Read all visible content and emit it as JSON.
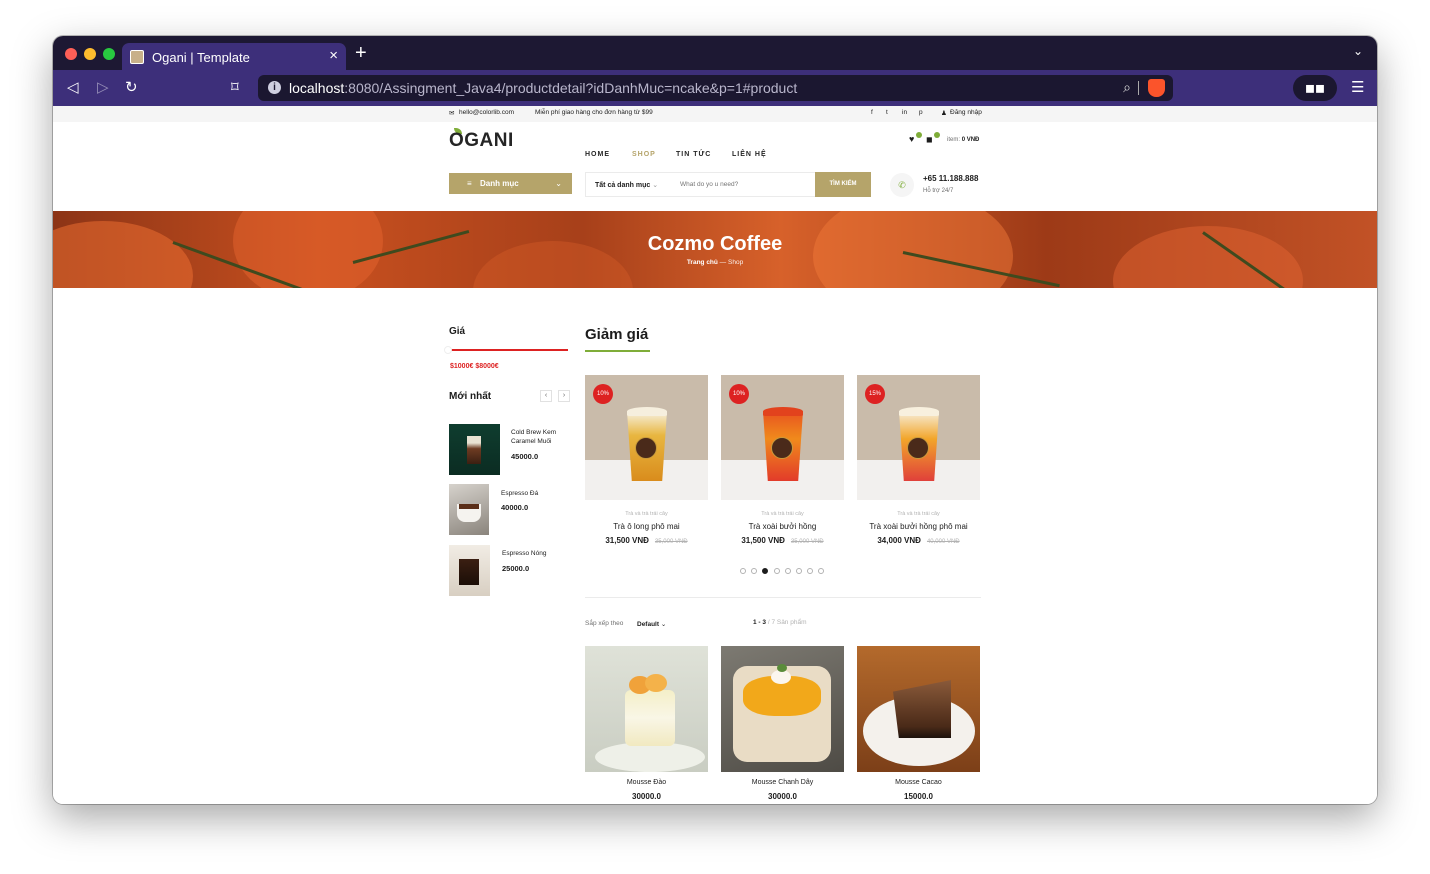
{
  "browser": {
    "tab_title": "Ogani | Template",
    "tab_close": "×",
    "new_tab": "+",
    "url_host": "localhost",
    "url_rest": ":8080/Assingment_Java4/productdetail?idDanhMuc=ncake&p=1#product",
    "info_symbol": "i",
    "icons": {
      "back": "◁",
      "forward": "▷",
      "reload": "↻",
      "bookmark": "⌑",
      "zoom": "⌕",
      "menu": "☰",
      "tab_list": "⌄",
      "glasses": "◼◼"
    }
  },
  "top_strip": {
    "email_icon": "✉",
    "email": "hello@colorlib.com",
    "shipping": "Miễn phí giao hàng cho đơn hàng từ $99",
    "social": [
      "f",
      "t",
      "in",
      "p"
    ],
    "login_icon": "♟",
    "login": "Đăng nhập"
  },
  "header": {
    "logo": "OGANI",
    "menu": [
      {
        "label": "HOME",
        "active": false
      },
      {
        "label": "SHOP",
        "active": true
      },
      {
        "label": "TIN TỨC",
        "active": false
      },
      {
        "label": "LIÊN HỆ",
        "active": false
      }
    ],
    "wishlist_icon": "♥",
    "cart_icon": "◼",
    "cart_label": "item:",
    "cart_total": "0 VNĐ",
    "categories_button": "Danh mục",
    "categories_icon": "≡",
    "categories_chevron": "⌄",
    "search_category": "Tất cả danh mục",
    "search_placeholder": "What do yo u need?",
    "search_button": "TÌM KIẾM",
    "phone_icon": "✆",
    "phone": "+65 11.188.888",
    "support": "Hỗ trợ 24/7"
  },
  "hero": {
    "title": "Cozmo Coffee",
    "breadcrumb_home": "Trang chủ",
    "breadcrumb_sep": " — ",
    "breadcrumb_current": "Shop"
  },
  "sidebar": {
    "price_title": "Giá",
    "price_min": "$1000€",
    "price_max": "$8000€",
    "latest_title": "Mới nhất",
    "prev": "‹",
    "next": "›",
    "latest": [
      {
        "name": "Cold Brew Kem Caramel Muối",
        "price": "45000.0"
      },
      {
        "name": "Espresso Đá",
        "price": "40000.0"
      },
      {
        "name": "Espresso Nóng",
        "price": "25000.0"
      }
    ]
  },
  "sale": {
    "title": "Giảm giá",
    "items": [
      {
        "discount": "10%",
        "category": "Trà và trà trái cây",
        "name": "Trà ô long phô mai",
        "price": "31,500 VNĐ",
        "old_price": "35,000 VNĐ"
      },
      {
        "discount": "10%",
        "category": "Trà và trà trái cây",
        "name": "Trà xoài bưởi hồng",
        "price": "31,500 VNĐ",
        "old_price": "35,000 VNĐ"
      },
      {
        "discount": "15%",
        "category": "Trà và trà trái cây",
        "name": "Trà xoài bưởi hồng phô mai",
        "price": "34,000 VNĐ",
        "old_price": "40,000 VNĐ"
      }
    ],
    "carousel_dots": 8,
    "carousel_active": 3
  },
  "listing": {
    "sort_label": "Sắp xếp theo",
    "sort_value": "Default",
    "sort_chevron": "⌄",
    "count_range": "1 - 3",
    "count_rest": "/ 7 Sản phẩm",
    "products": [
      {
        "name": "Mousse Đào",
        "price": "30000.0"
      },
      {
        "name": "Mousse Chanh Dây",
        "price": "30000.0"
      },
      {
        "name": "Mousse Cacao",
        "price": "15000.0"
      }
    ]
  },
  "colors": {
    "accent": "#b5a46a",
    "green": "#7fad39",
    "sale_red": "#dd2222",
    "browser_purple": "#3d2f7a"
  }
}
